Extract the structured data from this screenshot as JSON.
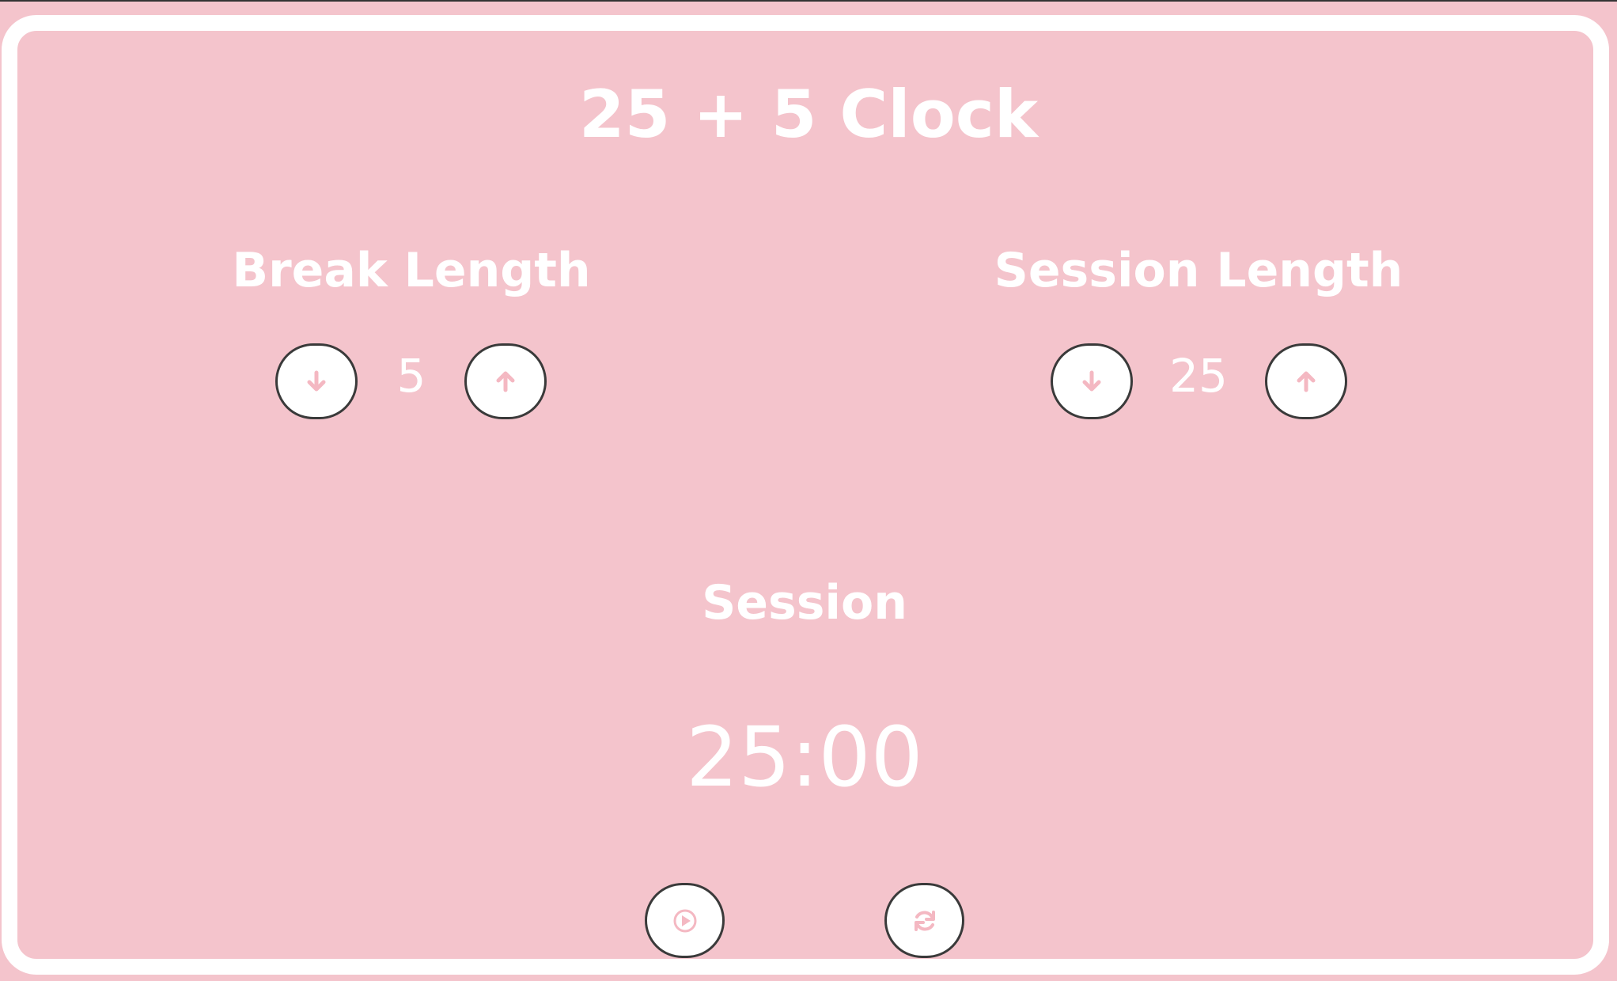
{
  "app": {
    "title": "25 + 5 Clock"
  },
  "break": {
    "label": "Break Length",
    "value": "5"
  },
  "session": {
    "label": "Session Length",
    "value": "25"
  },
  "timer": {
    "label": "Session",
    "time": "25:00"
  },
  "icons": {
    "decrement": "arrow-down-icon",
    "increment": "arrow-up-icon",
    "start_stop": "play-icon",
    "reset": "refresh-icon"
  },
  "colors": {
    "background": "#f4c4cc",
    "text": "#ffffff",
    "button_fill": "#ffffff",
    "button_border": "#3a3a3a",
    "icon": "#f4b8c2"
  }
}
